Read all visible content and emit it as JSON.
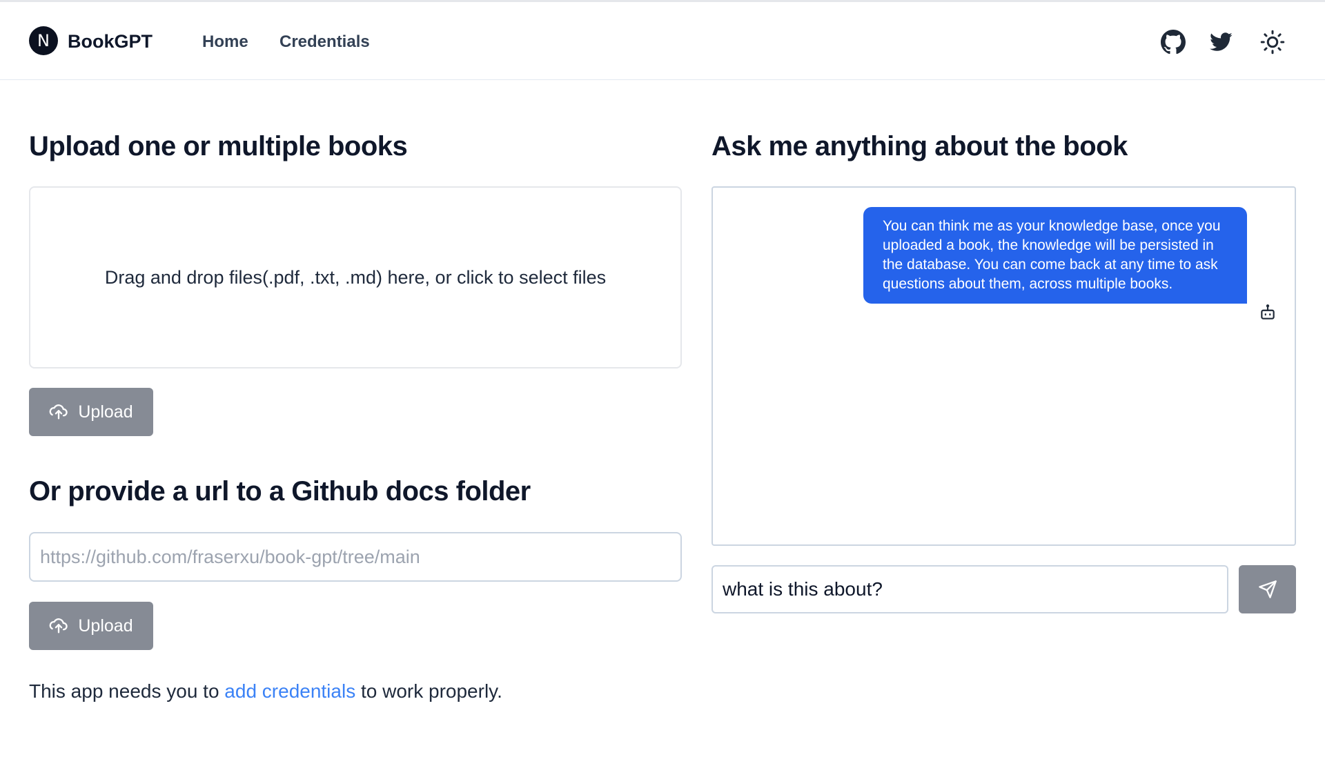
{
  "header": {
    "logo_letter": "N",
    "brand": "BookGPT",
    "nav": [
      {
        "label": "Home"
      },
      {
        "label": "Credentials"
      }
    ]
  },
  "upload": {
    "title": "Upload one or multiple books",
    "dropzone_text": "Drag and drop files(.pdf, .txt, .md) here, or click to select files",
    "button_label": "Upload"
  },
  "github": {
    "title": "Or provide a url to a Github docs folder",
    "placeholder": "https://github.com/fraserxu/book-gpt/tree/main",
    "button_label": "Upload"
  },
  "note": {
    "prefix": "This app needs you to ",
    "link": "add credentials",
    "suffix": " to work properly."
  },
  "chat": {
    "title": "Ask me anything about the book",
    "message": "You can think me as your knowledge base, once you uploaded a book, the knowledge will be persisted in the database. You can come back at any time to ask questions about them, across multiple books.",
    "input_value": "what is this about?"
  },
  "colors": {
    "accent": "#2563eb",
    "button_gray": "#868b95",
    "link": "#3b82f6"
  },
  "icons": {
    "github": "github-icon",
    "twitter": "twitter-icon",
    "theme": "sun-icon",
    "upload": "cloud-upload-icon",
    "bot": "robot-icon",
    "send": "send-icon"
  }
}
